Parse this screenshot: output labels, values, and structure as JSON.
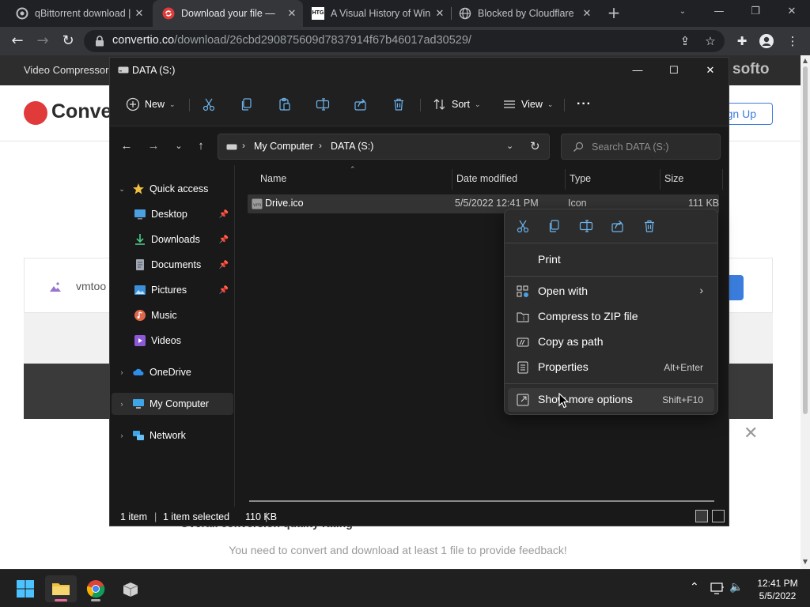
{
  "browser": {
    "tabs": [
      {
        "title": "qBittorrent download | ",
        "icon": "qbittorrent-icon"
      },
      {
        "title": "Download your file — ",
        "icon": "convertio-icon",
        "active": true
      },
      {
        "title": "A Visual History of Win",
        "icon": "htg-icon",
        "favicon_text": "HTG"
      },
      {
        "title": "Blocked by Cloudflare",
        "icon": "globe-icon"
      }
    ],
    "new_tab_label": "+",
    "url_host": "convertio.co",
    "url_path": "/download/26cbd290875609d7837914f67b46017ad30529/"
  },
  "webpage": {
    "nav_item": "Video Compressor",
    "brand_right": "softo",
    "logo_text": "Conve",
    "signup_label": "gn Up",
    "file_name": "vmtoo",
    "rating_text": "Overall conversion quality rating",
    "notice": "You need to convert and download at least 1 file to provide feedback!",
    "close_glyph": "✕"
  },
  "explorer": {
    "title": "DATA (S:)",
    "commands": {
      "new_label": "New",
      "sort_label": "Sort",
      "view_label": "View",
      "more_label": "···"
    },
    "breadcrumb": [
      "My Computer",
      "DATA (S:)"
    ],
    "search_placeholder": "Search DATA (S:)",
    "nav": {
      "quick_access": "Quick access",
      "desktop": "Desktop",
      "downloads": "Downloads",
      "documents": "Documents",
      "pictures": "Pictures",
      "music": "Music",
      "videos": "Videos",
      "onedrive": "OneDrive",
      "my_computer": "My Computer",
      "network": "Network"
    },
    "columns": {
      "name": "Name",
      "date": "Date modified",
      "type": "Type",
      "size": "Size"
    },
    "file": {
      "name": "Drive.ico",
      "date": "5/5/2022 12:41 PM",
      "type": "Icon",
      "size": "111 KB"
    },
    "status": {
      "count": "1 item",
      "selected": "1 item selected",
      "size": "110 KB",
      "sep": "|"
    }
  },
  "context_menu": {
    "print": "Print",
    "open_with": "Open with",
    "compress": "Compress to ZIP file",
    "copy_path": "Copy as path",
    "properties": "Properties",
    "properties_key": "Alt+Enter",
    "more_options": "Show more options",
    "more_options_key": "Shift+F10"
  },
  "taskbar": {
    "time": "12:41 PM",
    "date": "5/5/2022"
  },
  "colors": {
    "explorer_bg": "#191919",
    "menu_bg": "#2c2c2c",
    "accent_folder": "#f0c040",
    "convertio_red": "#e03a3a",
    "link_blue": "#3b7ddd"
  }
}
